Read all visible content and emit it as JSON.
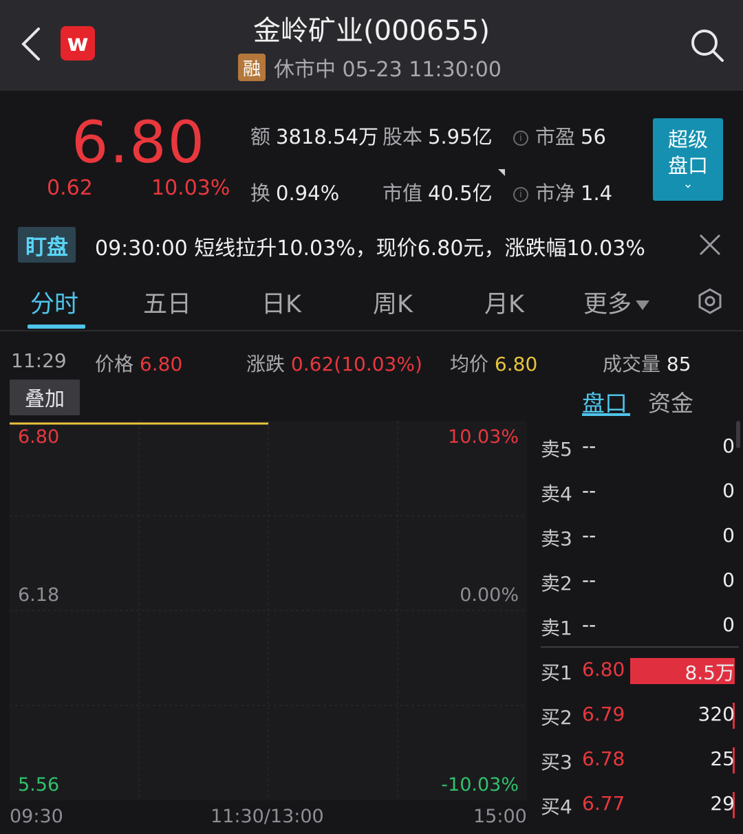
{
  "header": {
    "title": "金岭矿业(000655)",
    "logo_letter": "w",
    "margin_badge": "融",
    "status": "休市中 05-23 11:30:00"
  },
  "quote": {
    "price": "6.80",
    "change": "0.62",
    "change_pct": "10.03%",
    "turnover_amount_label": "额",
    "turnover_amount": "3818.54万",
    "share_capital_label": "股本",
    "share_capital": "5.95亿",
    "pe_label": "市盈",
    "pe": "56",
    "turnover_rate_label": "换",
    "turnover_rate": "0.94%",
    "market_cap_label": "市值",
    "market_cap": "40.5亿",
    "pb_label": "市净",
    "pb": "1.4",
    "info_glyph": "i",
    "super_button_line1": "超级",
    "super_button_line2": "盘口",
    "super_button_chevron": "⌄"
  },
  "alert": {
    "tag": "盯盘",
    "text": "09:30:00 短线拉升10.03%，现价6.80元，涨跌幅10.03%"
  },
  "tabs": [
    "分时",
    "五日",
    "日K",
    "周K",
    "月K",
    "更多"
  ],
  "crosshair": {
    "time": "11:29",
    "price_label": "价格",
    "price": "6.80",
    "change_label": "涨跌",
    "change": "0.62(10.03%)",
    "avg_label": "均价",
    "avg": "6.80",
    "volume_label": "成交量",
    "volume": "85"
  },
  "overlay_button": "叠加",
  "side_tabs": [
    "盘口",
    "资金"
  ],
  "chart_data": {
    "type": "line",
    "title": "",
    "x_ticks": [
      "09:30",
      "11:30/13:00",
      "15:00"
    ],
    "y_left_ticks": [
      "6.80",
      "6.18",
      "5.56"
    ],
    "y_right_ticks": [
      "10.03%",
      "0.00%",
      "-10.03%"
    ],
    "ylim": [
      5.56,
      6.8
    ],
    "series": [
      {
        "values": [
          6.8,
          6.8
        ]
      }
    ],
    "session_progress": 0.5,
    "colors": {
      "price_line": "#e8c43a",
      "up": "#e8383d",
      "down": "#2fc26a"
    }
  },
  "order_book": {
    "asks": [
      {
        "label": "卖5",
        "price": "--",
        "volume": "0"
      },
      {
        "label": "卖4",
        "price": "--",
        "volume": "0"
      },
      {
        "label": "卖3",
        "price": "--",
        "volume": "0"
      },
      {
        "label": "卖2",
        "price": "--",
        "volume": "0"
      },
      {
        "label": "卖1",
        "price": "--",
        "volume": "0"
      }
    ],
    "bids": [
      {
        "label": "买1",
        "price": "6.80",
        "volume": "8.5万",
        "bar_fraction": 1.0
      },
      {
        "label": "买2",
        "price": "6.79",
        "volume": "320",
        "bar_fraction": 0.015
      },
      {
        "label": "买3",
        "price": "6.78",
        "volume": "25",
        "bar_fraction": 0.01
      },
      {
        "label": "买4",
        "price": "6.77",
        "volume": "29",
        "bar_fraction": 0.01
      }
    ]
  }
}
